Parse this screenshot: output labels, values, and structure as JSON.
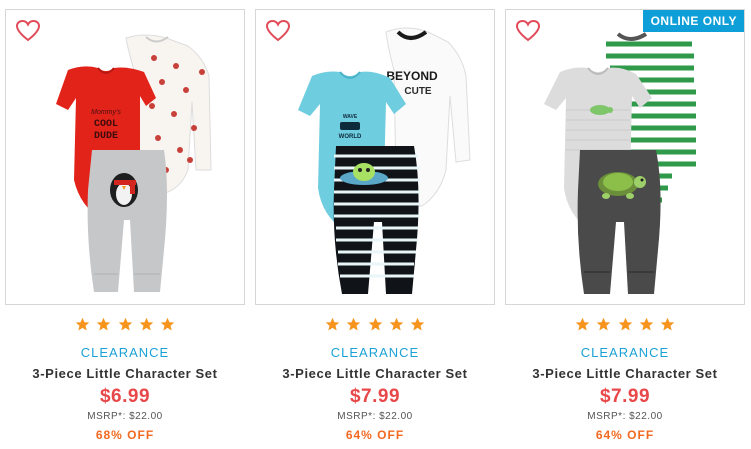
{
  "products": [
    {
      "badge": "",
      "rating_stars": 5,
      "tag": "CLEARANCE",
      "name": "3-Piece Little Character Set",
      "price": "$6.99",
      "msrp": "MSRP*: $22.00",
      "discount": "68% OFF",
      "shirt_text": [
        "Mommy's",
        "COOL",
        "DUDE"
      ]
    },
    {
      "badge": "",
      "rating_stars": 5,
      "tag": "CLEARANCE",
      "name": "3-Piece Little Character Set",
      "price": "$7.99",
      "msrp": "MSRP*: $22.00",
      "discount": "64% OFF",
      "shirt_text": [
        "BEYOND",
        "CUTE",
        "WORLD"
      ]
    },
    {
      "badge": "ONLINE ONLY",
      "rating_stars": 5,
      "tag": "CLEARANCE",
      "name": "3-Piece Little Character Set",
      "price": "$7.99",
      "msrp": "MSRP*: $22.00",
      "discount": "64% OFF",
      "shirt_text": []
    }
  ],
  "colors": {
    "clearance": "#1ba1d6",
    "price": "#e8484a",
    "discount": "#f26a22",
    "star": "#f7941d",
    "heart": "#e14b5a",
    "badge_bg": "#0e9fd8"
  },
  "icons": {
    "wishlist": "heart-outline-icon",
    "rating": "star-icon"
  }
}
